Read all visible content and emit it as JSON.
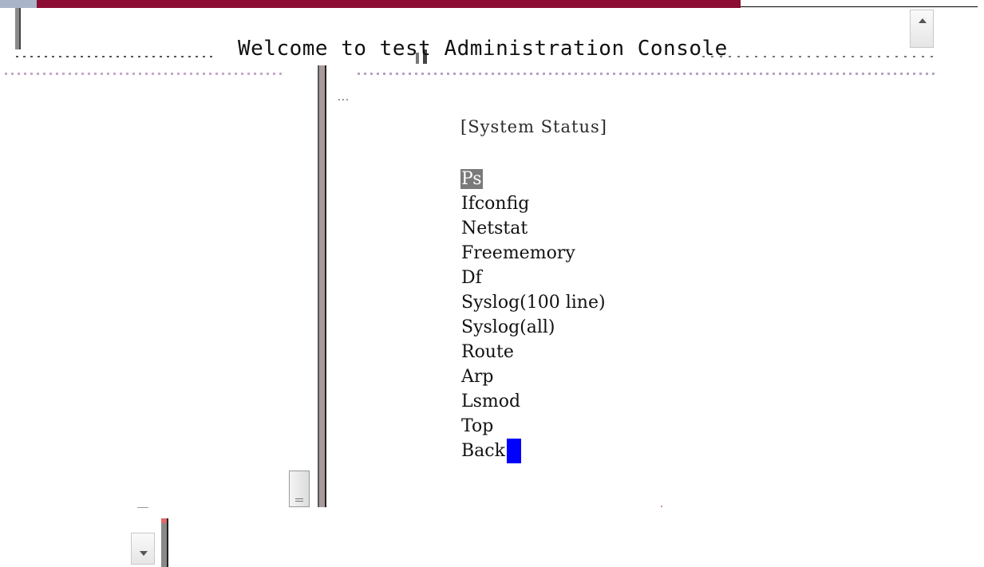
{
  "header": {
    "title": "Welcome to test Administration Console"
  },
  "menu": {
    "heading": "[System Status]",
    "items": [
      {
        "label": "Ps",
        "selected": true
      },
      {
        "label": "Ifconfig",
        "selected": false
      },
      {
        "label": "Netstat",
        "selected": false
      },
      {
        "label": "Freememory",
        "selected": false
      },
      {
        "label": "Df",
        "selected": false
      },
      {
        "label": "Syslog(100 line)",
        "selected": false
      },
      {
        "label": "Syslog(all)",
        "selected": false
      },
      {
        "label": "Route",
        "selected": false
      },
      {
        "label": "Arp",
        "selected": false
      },
      {
        "label": "Lsmod",
        "selected": false
      },
      {
        "label": "Top",
        "selected": false
      },
      {
        "label": "Back",
        "selected": false
      }
    ]
  },
  "colors": {
    "accent_bar": "#8b0d33",
    "selection_bg": "#7a7a7a",
    "cursor": "#0000ff"
  }
}
